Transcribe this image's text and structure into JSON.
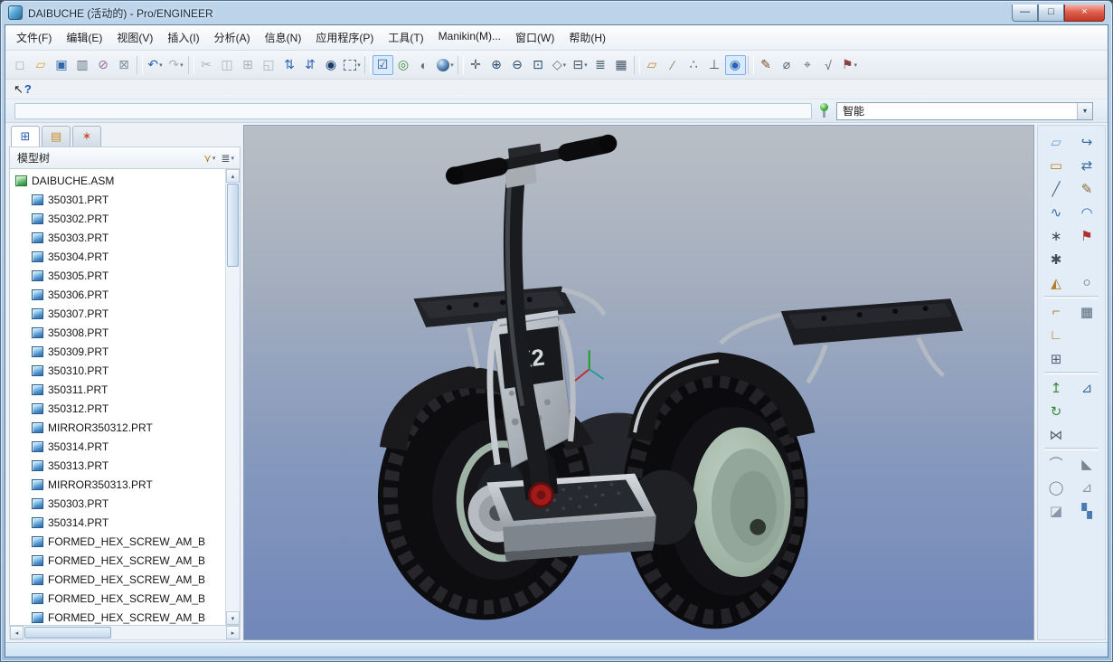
{
  "window": {
    "title": "DAIBUCHE (活动的) - Pro/ENGINEER",
    "controls": {
      "minimize": "—",
      "maximize": "□",
      "close": "×"
    }
  },
  "menu": {
    "items": [
      "文件(F)",
      "编辑(E)",
      "视图(V)",
      "插入(I)",
      "分析(A)",
      "信息(N)",
      "应用程序(P)",
      "工具(T)",
      "Manikin(M)...",
      "窗口(W)",
      "帮助(H)"
    ]
  },
  "toolbar": {
    "icons": [
      {
        "kind": "icon",
        "name": "new-file-icon",
        "glyph": "□",
        "style": "color:#8898a8"
      },
      {
        "kind": "icon",
        "name": "open-icon",
        "glyph": "▱",
        "style": "color:#d8a030"
      },
      {
        "kind": "icon",
        "name": "save-icon",
        "glyph": "▣",
        "style": "color:#3068a8"
      },
      {
        "kind": "icon",
        "name": "print-icon",
        "glyph": "▥",
        "style": "color:#607080"
      },
      {
        "kind": "icon",
        "name": "erase-display-icon",
        "glyph": "⊘",
        "style": "color:#9070a0"
      },
      {
        "kind": "icon",
        "name": "delete-old-versions-icon",
        "glyph": "⊠",
        "style": "color:#8090a0"
      },
      {
        "kind": "sep"
      },
      {
        "kind": "icon",
        "name": "undo-icon",
        "glyph": "↶",
        "style": "color:#2a62b8",
        "caret": "▾"
      },
      {
        "kind": "icon",
        "name": "redo-icon",
        "glyph": "↷",
        "style": "color:#a8b2bc",
        "caret": "▾"
      },
      {
        "kind": "sep"
      },
      {
        "kind": "icon",
        "name": "cut-icon",
        "glyph": "✂",
        "style": "color:#a8b2bc"
      },
      {
        "kind": "icon",
        "name": "copy-icon",
        "glyph": "◫",
        "style": "color:#a8b2bc"
      },
      {
        "kind": "icon",
        "name": "paste-icon",
        "glyph": "⊞",
        "style": "color:#a8b2bc"
      },
      {
        "kind": "icon",
        "name": "paste-special-icon",
        "glyph": "◱",
        "style": "color:#a8b2bc"
      },
      {
        "kind": "icon",
        "name": "regenerate-icon",
        "glyph": "⇅",
        "style": "color:#2a62b8"
      },
      {
        "kind": "icon",
        "name": "regenerate-manager-icon",
        "glyph": "⇵",
        "style": "color:#2a62b8"
      },
      {
        "kind": "icon",
        "name": "find-icon",
        "glyph": "◉",
        "style": "color:#1a3a6a"
      },
      {
        "kind": "icon",
        "name": "select-rectangle-icon",
        "glyph": "",
        "style": "color:#4a6a8a",
        "caret": "▾"
      },
      {
        "kind": "sep"
      },
      {
        "kind": "icon",
        "name": "select-items-icon",
        "glyph": "☑",
        "style": "color:#2a5a9a;background:#d8eafc;border:1px solid #7ab0e8"
      },
      {
        "kind": "icon",
        "name": "selection-filter-icon",
        "glyph": "◎",
        "style": "color:#3a8a3a"
      },
      {
        "kind": "icon",
        "name": "appearance-icon",
        "glyph": "◐",
        "style": "color:#607080"
      },
      {
        "kind": "icon",
        "name": "shaded-view-icon",
        "glyph": "",
        "style": "",
        "caret": "▾"
      },
      {
        "kind": "sep"
      },
      {
        "kind": "icon",
        "name": "spin-pan-icon",
        "glyph": "✛",
        "style": "color:#555f6a"
      },
      {
        "kind": "icon",
        "name": "zoom-in-icon",
        "glyph": "⊕",
        "style": "color:#2a4a6a"
      },
      {
        "kind": "icon",
        "name": "zoom-out-icon",
        "glyph": "⊖",
        "style": "color:#2a4a6a"
      },
      {
        "kind": "icon",
        "name": "refit-icon",
        "glyph": "⊡",
        "style": "color:#2a4a6a"
      },
      {
        "kind": "icon",
        "name": "orient-icon",
        "glyph": "◇",
        "style": "color:#607080",
        "caret": "▾"
      },
      {
        "kind": "icon",
        "name": "saved-views-icon",
        "glyph": "⊟",
        "style": "color:#445566",
        "caret": "▾"
      },
      {
        "kind": "icon",
        "name": "layers-icon",
        "glyph": "≣",
        "style": "color:#445566"
      },
      {
        "kind": "icon",
        "name": "view-manager-icon",
        "glyph": "▦",
        "style": "color:#445566"
      },
      {
        "kind": "sep"
      },
      {
        "kind": "icon",
        "name": "datum-planes-toggle-icon",
        "glyph": "▱",
        "style": "color:#c08030"
      },
      {
        "kind": "icon",
        "name": "datum-axes-toggle-icon",
        "glyph": "∕",
        "style": "color:#887848"
      },
      {
        "kind": "icon",
        "name": "datum-points-toggle-icon",
        "glyph": "∴",
        "style": "color:#445566"
      },
      {
        "kind": "icon",
        "name": "datum-csys-toggle-icon",
        "glyph": "⊥",
        "style": "color:#445566"
      },
      {
        "kind": "icon",
        "name": "spin-center-toggle-icon",
        "glyph": "◉",
        "style": "color:#2a62b8;background:#d8eafc;border:1px solid #7ab0e8"
      },
      {
        "kind": "sep"
      },
      {
        "kind": "icon",
        "name": "annotation-note-icon",
        "glyph": "✎",
        "style": "color:#7a5030"
      },
      {
        "kind": "icon",
        "name": "annotation-dimension-icon",
        "glyph": "⌀",
        "style": "color:#556677"
      },
      {
        "kind": "icon",
        "name": "annotation-gtol-icon",
        "glyph": "⌖",
        "style": "color:#556677"
      },
      {
        "kind": "icon",
        "name": "annotation-surface-finish-icon",
        "glyph": "√",
        "style": "color:#556677"
      },
      {
        "kind": "icon",
        "name": "annotation-designate-icon",
        "glyph": "⚑",
        "style": "color:#884444",
        "caret": "▾"
      }
    ]
  },
  "help_row": {
    "arrow": "↖",
    "question": "?"
  },
  "filter_bar": {
    "selector_value": "智能",
    "dropdown_glyph": "▾"
  },
  "scrollbar": {
    "up": "▴",
    "down": "▾",
    "left": "◂",
    "right": "▸"
  },
  "model_tree": {
    "title": "模型树",
    "tabs": [
      {
        "name": "model-tree-tab",
        "glyph": "⊞",
        "style": "color:#2a62b8",
        "active": "true"
      },
      {
        "name": "folder-browser-tab",
        "glyph": "▤",
        "style": "color:#c89030"
      },
      {
        "name": "favorites-tab",
        "glyph": "✶",
        "style": "color:#c85030"
      }
    ],
    "header_buttons": [
      {
        "name": "show-filter-dropdown",
        "glyph": "⋎",
        "caret": "▾",
        "style": "color:#b08030"
      },
      {
        "name": "settings-dropdown",
        "glyph": "≣",
        "caret": "▾",
        "style": "color:#445566"
      }
    ],
    "items": [
      {
        "label": "DAIBUCHE.ASM",
        "icon": "asm",
        "indent": "0"
      },
      {
        "label": "350301.PRT",
        "icon": "prt",
        "indent": "1"
      },
      {
        "label": "350302.PRT",
        "icon": "prt",
        "indent": "1"
      },
      {
        "label": "350303.PRT",
        "icon": "prt",
        "indent": "1"
      },
      {
        "label": "350304.PRT",
        "icon": "prt",
        "indent": "1"
      },
      {
        "label": "350305.PRT",
        "icon": "prt",
        "indent": "1"
      },
      {
        "label": "350306.PRT",
        "icon": "prt",
        "indent": "1"
      },
      {
        "label": "350307.PRT",
        "icon": "prt",
        "indent": "1"
      },
      {
        "label": "350308.PRT",
        "icon": "prt",
        "indent": "1"
      },
      {
        "label": "350309.PRT",
        "icon": "prt",
        "indent": "1"
      },
      {
        "label": "350310.PRT",
        "icon": "prt",
        "indent": "1"
      },
      {
        "label": "350311.PRT",
        "icon": "prt",
        "indent": "1"
      },
      {
        "label": "350312.PRT",
        "icon": "prt",
        "indent": "1"
      },
      {
        "label": "MIRROR350312.PRT",
        "icon": "prt",
        "indent": "1"
      },
      {
        "label": "350314.PRT",
        "icon": "prt",
        "indent": "1"
      },
      {
        "label": "350313.PRT",
        "icon": "prt",
        "indent": "1"
      },
      {
        "label": "MIRROR350313.PRT",
        "icon": "prt",
        "indent": "1"
      },
      {
        "label": "350303.PRT",
        "icon": "prt",
        "indent": "1"
      },
      {
        "label": "350314.PRT",
        "icon": "prt",
        "indent": "1"
      },
      {
        "label": "FORMED_HEX_SCREW_AM_B",
        "icon": "prt",
        "indent": "1"
      },
      {
        "label": "FORMED_HEX_SCREW_AM_B",
        "icon": "prt",
        "indent": "1"
      },
      {
        "label": "FORMED_HEX_SCREW_AM_B",
        "icon": "prt",
        "indent": "1"
      },
      {
        "label": "FORMED_HEX_SCREW_AM_B",
        "icon": "prt",
        "indent": "1"
      },
      {
        "label": "FORMED_HEX_SCREW_AM_B",
        "icon": "prt",
        "indent": "1"
      }
    ]
  },
  "right_toolbar": {
    "icons": [
      {
        "kind": "icon",
        "name": "sketch-region-icon",
        "glyph": "▱",
        "style": "color:#6aa0d8"
      },
      {
        "kind": "icon",
        "name": "style-tool-icon",
        "glyph": "↪",
        "style": "color:#3a6aa0"
      },
      {
        "kind": "icon",
        "name": "datum-plane-icon",
        "glyph": "▭",
        "style": "color:#c87828"
      },
      {
        "kind": "icon",
        "name": "swap-tool-icon",
        "glyph": "⇄",
        "style": "color:#3a6aa0"
      },
      {
        "kind": "icon",
        "name": "line-tool-icon",
        "glyph": "╱",
        "style": "color:#4a6a8a"
      },
      {
        "kind": "icon",
        "name": "sketch-tool-icon",
        "glyph": "✎",
        "style": "color:#8a6a3a"
      },
      {
        "kind": "icon",
        "name": "spline-tool-icon",
        "glyph": "∿",
        "style": "color:#3a6aa0"
      },
      {
        "kind": "icon",
        "name": "surface-tool-icon",
        "glyph": "◠",
        "style": "color:#3a6aa0"
      },
      {
        "kind": "icon",
        "name": "point-tool-icon",
        "glyph": "∗",
        "style": "color:#444c55"
      },
      {
        "kind": "icon",
        "name": "flag-note-icon",
        "glyph": "⚑",
        "style": "color:#b03030"
      },
      {
        "kind": "icon",
        "name": "axis-point-icon",
        "glyph": "✱",
        "style": "color:#444c55"
      },
      {
        "kind": "blank"
      },
      {
        "kind": "icon",
        "name": "hatch-tool-icon",
        "glyph": "◭",
        "style": "color:#b08030"
      },
      {
        "kind": "icon",
        "name": "balloon-tool-icon",
        "glyph": "○",
        "style": "color:#556677"
      },
      {
        "kind": "hr"
      },
      {
        "kind": "icon",
        "name": "use-edge-icon",
        "glyph": "⌐",
        "style": "color:#b08030"
      },
      {
        "kind": "icon",
        "name": "grid-tool-icon",
        "glyph": "▦",
        "style": "color:#556677"
      },
      {
        "kind": "icon",
        "name": "offset-edge-icon",
        "glyph": "∟",
        "style": "color:#b08030"
      },
      {
        "kind": "blank"
      },
      {
        "kind": "icon",
        "name": "copy-geometry-icon",
        "glyph": "⊞",
        "style": "color:#556677"
      },
      {
        "kind": "blank"
      },
      {
        "kind": "hr"
      },
      {
        "kind": "icon",
        "name": "extrude-tool-icon",
        "glyph": "↥",
        "style": "color:#3a8a3a"
      },
      {
        "kind": "icon",
        "name": "sketch-view-icon",
        "glyph": "⊿",
        "style": "color:#3a6aa0"
      },
      {
        "kind": "icon",
        "name": "revolve-tool-icon",
        "glyph": "↻",
        "style": "color:#3a8a3a"
      },
      {
        "kind": "blank"
      },
      {
        "kind": "icon",
        "name": "mirror-tool-icon",
        "glyph": "⋈",
        "style": "color:#556677"
      },
      {
        "kind": "blank"
      },
      {
        "kind": "hr"
      },
      {
        "kind": "icon",
        "name": "round-tool-icon",
        "glyph": "⌒",
        "style": "color:#788590"
      },
      {
        "kind": "icon",
        "name": "chamfer-tool-icon",
        "glyph": "◣",
        "style": "color:#788590"
      },
      {
        "kind": "icon",
        "name": "shell-tool-icon",
        "glyph": "◯",
        "style": "color:#788590"
      },
      {
        "kind": "icon",
        "name": "draft-tool-icon",
        "glyph": "⊿",
        "style": "color:#8898a8"
      },
      {
        "kind": "icon",
        "name": "rib-tool-icon",
        "glyph": "◪",
        "style": "color:#8898a8"
      },
      {
        "kind": "icon",
        "name": "pattern-tool-icon",
        "glyph": "▚",
        "style": "color:#4a7ab0"
      }
    ]
  },
  "viewport": {
    "model_badge": "X2"
  },
  "status_bar": {
    "text": ""
  }
}
